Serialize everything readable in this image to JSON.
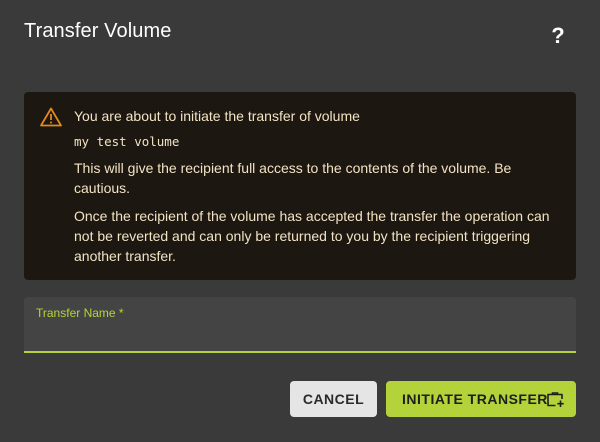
{
  "dialog": {
    "title": "Transfer Volume",
    "help_icon": "question-mark-icon",
    "help_glyph": "?"
  },
  "warning": {
    "icon": "warning-triangle-icon",
    "color": "#e08a1e",
    "intro": "You are about to initiate the transfer of volume",
    "volume_name": "my test volume",
    "paragraph1": "This will give the recipient full access to the contents of the volume. Be cautious.",
    "paragraph2": "Once the recipient of the volume has accepted the transfer the operation can not be reverted and can only be returned to you by the recipient triggering another transfer."
  },
  "form": {
    "transfer_name_label": "Transfer Name *",
    "transfer_name_value": "",
    "accent": "#b4d33a"
  },
  "actions": {
    "cancel_label": "CANCEL",
    "initiate_label": "INITIATE TRANSFER",
    "initiate_icon": "briefcase-plus-icon"
  }
}
